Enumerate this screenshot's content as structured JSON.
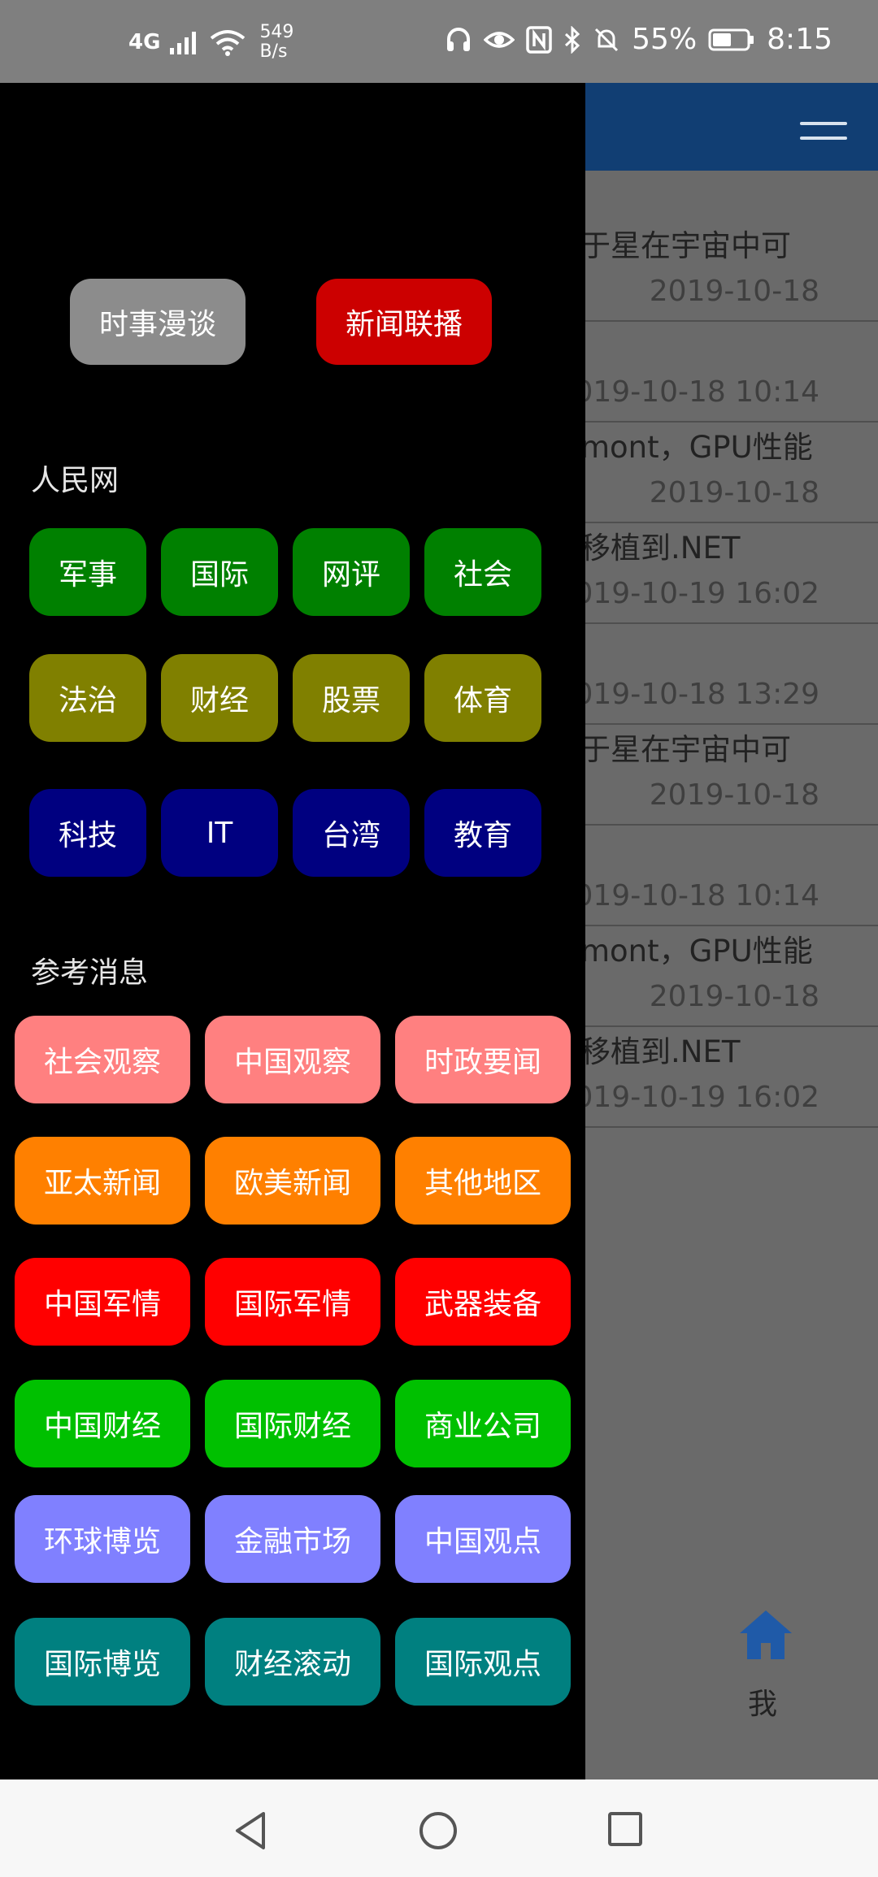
{
  "status_bar": {
    "network": "4G",
    "speed_value": "549",
    "speed_unit": "B/s",
    "battery_pct": "55%",
    "time": "8:15",
    "icons": [
      "signal-icon",
      "wifi-icon",
      "headphones-icon",
      "eye-icon",
      "nfc-icon",
      "bluetooth-icon",
      "bell-off-icon",
      "battery-icon"
    ]
  },
  "app": {
    "articles": [
      {
        "date": "2019-10-18",
        "title": "于星在宇宙中可"
      },
      {
        "date": "019-10-18 10:14",
        "title": ""
      },
      {
        "date": "2019-10-18",
        "title": "mont，GPU性能"
      },
      {
        "date": "019-10-19 16:02",
        "title": "移植到.NET"
      },
      {
        "date": "019-10-18 13:29",
        "title": ""
      },
      {
        "date": "2019-10-18",
        "title": "于星在宇宙中可"
      },
      {
        "date": "019-10-18 10:14",
        "title": ""
      },
      {
        "date": "2019-10-18",
        "title": "mont，GPU性能"
      },
      {
        "date": "019-10-19 16:02",
        "title": "移植到.NET"
      }
    ],
    "tab_label": "我",
    "colors": {
      "header": "#113e73",
      "overlay": "#6a6a6a"
    }
  },
  "drawer": {
    "top_buttons": [
      {
        "label": "时事漫谈",
        "color": "#8c8c8c"
      },
      {
        "label": "新闻联播",
        "color": "#cc0000"
      }
    ],
    "section_renmin": "人民网",
    "renmin_rows": [
      {
        "color": "#008000",
        "items": [
          "军事",
          "国际",
          "网评",
          "社会"
        ]
      },
      {
        "color": "#808000",
        "items": [
          "法治",
          "财经",
          "股票",
          "体育"
        ]
      },
      {
        "color": "#000080",
        "items": [
          "科技",
          "IT",
          "台湾",
          "教育"
        ]
      }
    ],
    "section_cankao": "参考消息",
    "cankao_rows": [
      {
        "color": "#ff8080",
        "items": [
          "社会观察",
          "中国观察",
          "时政要闻"
        ]
      },
      {
        "color": "#ff8000",
        "items": [
          "亚太新闻",
          "欧美新闻",
          "其他地区"
        ]
      },
      {
        "color": "#ff0000",
        "items": [
          "中国军情",
          "国际军情",
          "武器装备"
        ]
      },
      {
        "color": "#00c000",
        "items": [
          "中国财经",
          "国际财经",
          "商业公司"
        ]
      },
      {
        "color": "#8080ff",
        "items": [
          "环球博览",
          "金融市场",
          "中国观点"
        ]
      },
      {
        "color": "#008080",
        "items": [
          "国际博览",
          "财经滚动",
          "国际观点"
        ]
      }
    ]
  },
  "nav_bar": {
    "icons": [
      "back-icon",
      "home-circle-icon",
      "recents-icon"
    ]
  }
}
